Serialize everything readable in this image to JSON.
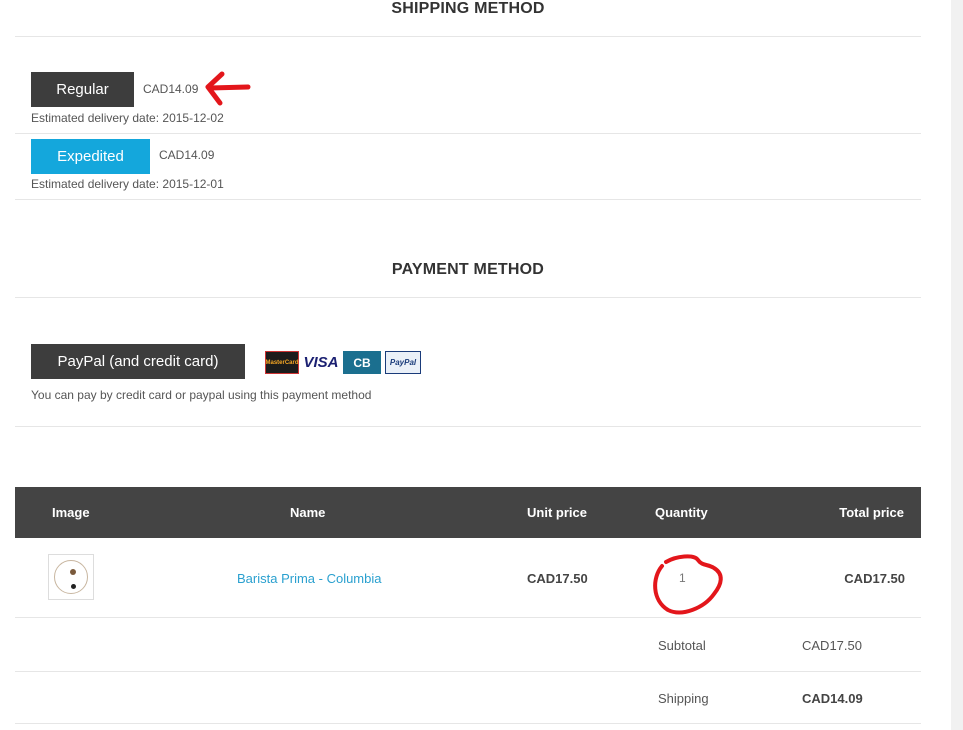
{
  "shipping": {
    "title": "SHIPPING METHOD",
    "options": [
      {
        "label": "Regular",
        "price": "CAD14.09",
        "delivery": "Estimated delivery date: 2015-12-02"
      },
      {
        "label": "Expedited",
        "price": "CAD14.09",
        "delivery": "Estimated delivery date: 2015-12-01"
      }
    ]
  },
  "payment": {
    "title": "PAYMENT METHOD",
    "option_label": "PayPal (and credit card)",
    "description": "You can pay by credit card or paypal using this payment method",
    "card_logos": {
      "mastercard": "MasterCard",
      "visa": "VISA",
      "cb": "CB",
      "paypal": "PayPal"
    }
  },
  "cart": {
    "headers": {
      "image": "Image",
      "name": "Name",
      "unit_price": "Unit price",
      "quantity": "Quantity",
      "total_price": "Total price"
    },
    "rows": [
      {
        "name": "Barista Prima - Columbia",
        "unit_price": "CAD17.50",
        "quantity": "1",
        "total_price": "CAD17.50"
      }
    ],
    "summary": [
      {
        "label": "Subtotal",
        "value": "CAD17.50"
      },
      {
        "label": "Shipping",
        "value": "CAD14.09"
      }
    ]
  },
  "colors": {
    "accent": "#14a7dc",
    "dark_button": "#3d3d3d",
    "table_header": "#444444",
    "annotation": "#e3161b"
  },
  "icons": {
    "thumbnail": "coffee-pod-image",
    "annotation_arrow": "red-arrow-icon",
    "annotation_circle": "red-circle-annotation"
  }
}
